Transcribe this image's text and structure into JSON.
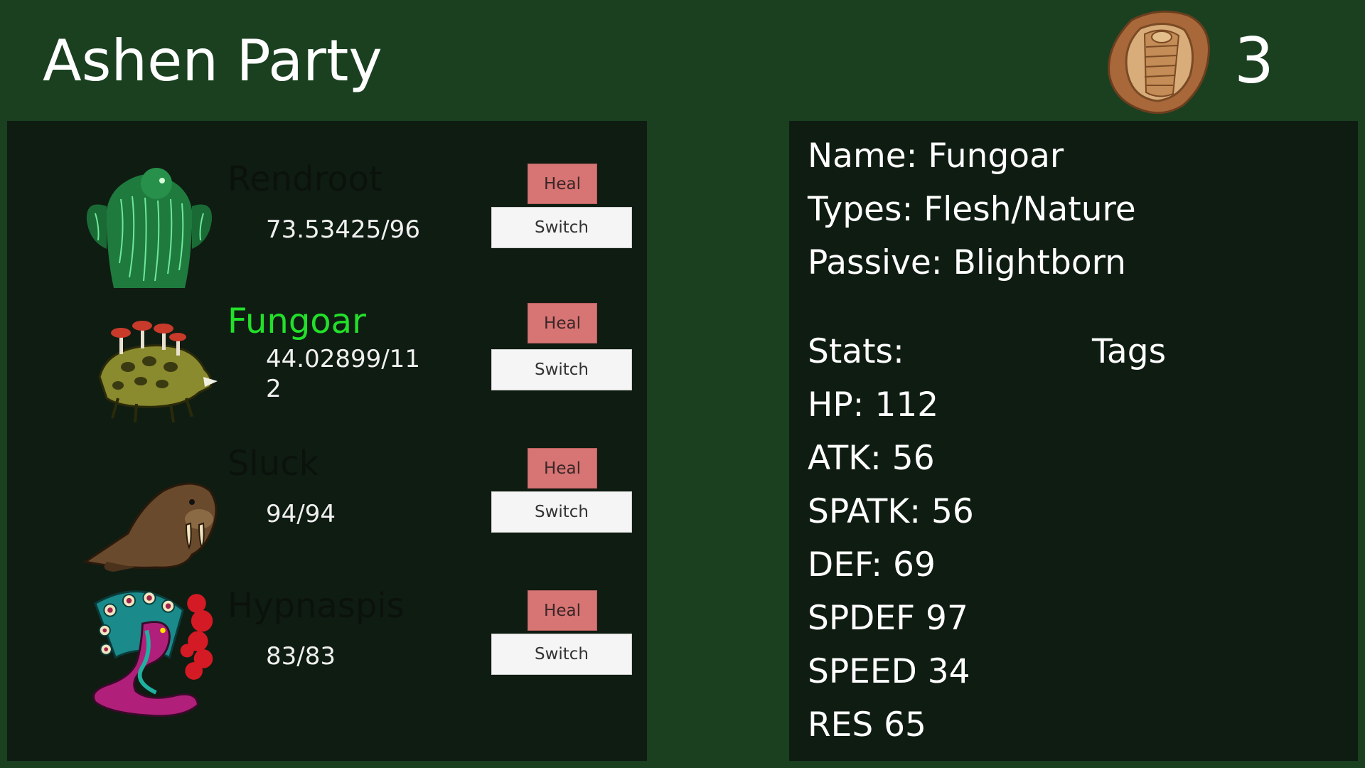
{
  "header": {
    "title": "Ashen Party",
    "fossil_icon": "trilobite-fossil-icon",
    "fossil_count": "3"
  },
  "party": [
    {
      "name": "Rendroot",
      "hp": "73.53425/96",
      "portrait": "green-moss-bear-icon",
      "selected": false
    },
    {
      "name": "Fungoar",
      "hp": "44.02899/112",
      "portrait": "mushroom-boar-icon",
      "selected": true
    },
    {
      "name": "Sluck",
      "hp": "94/94",
      "portrait": "walrus-icon",
      "selected": false
    },
    {
      "name": "Hypnaspis",
      "hp": "83/83",
      "portrait": "hooded-serpent-icon",
      "selected": false
    }
  ],
  "buttons": {
    "heal_label": "Heal",
    "switch_label": "Switch"
  },
  "details": {
    "name": "Name: Fungoar",
    "types": "Types: Flesh/Nature",
    "passive": "Passive: Blightborn",
    "stats_label": "Stats:",
    "tags_label": "Tags",
    "hp": "HP: 112",
    "atk": "ATK: 56",
    "spatk": "SPATK: 56",
    "def": "DEF: 69",
    "spdef": "SPDEF 97",
    "speed": "SPEED 34",
    "res": "RES 65"
  },
  "colors": {
    "background": "#1a4020",
    "panel": "#0f1c12",
    "selected_name": "#22e02a",
    "heal_button": "#d77474",
    "switch_button": "#f5f5f5"
  }
}
